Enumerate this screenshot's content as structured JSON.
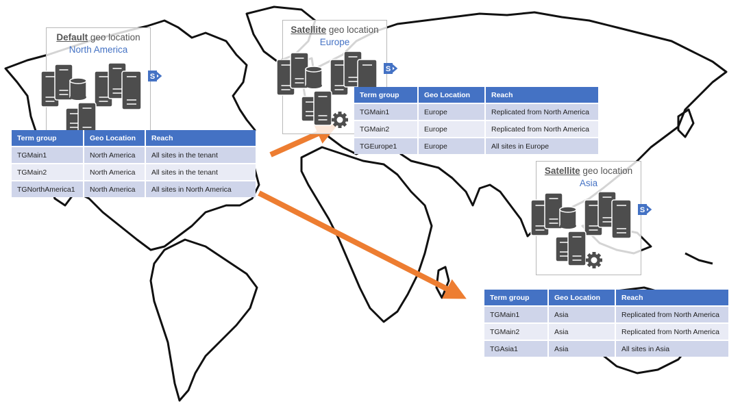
{
  "colors": {
    "accent": "#4472c4",
    "arrow": "#ed7d31",
    "server": "#4d4d4d",
    "row_odd": "#cfd5ea",
    "row_even": "#e9ebf5"
  },
  "table_headers": [
    "Term group",
    "Geo Location",
    "Reach"
  ],
  "locations": [
    {
      "kind": "Default",
      "suffix": " geo location",
      "name": "North America",
      "rows": [
        [
          "TGMain1",
          "North America",
          "All sites in the tenant"
        ],
        [
          "TGMain2",
          "North America",
          "All sites in the tenant"
        ],
        [
          "TGNorthAmerica1",
          "North America",
          "All sites in North America"
        ]
      ]
    },
    {
      "kind": "Satellite",
      "suffix": " geo location",
      "name": "Europe",
      "rows": [
        [
          "TGMain1",
          "Europe",
          "Replicated from North America"
        ],
        [
          "TGMain2",
          "Europe",
          "Replicated from North America"
        ],
        [
          "TGEurope1",
          "Europe",
          "All sites in Europe"
        ]
      ]
    },
    {
      "kind": "Satellite",
      "suffix": " geo location",
      "name": "Asia",
      "rows": [
        [
          "TGMain1",
          "Asia",
          "Replicated from North America"
        ],
        [
          "TGMain2",
          "Asia",
          "Replicated from North America"
        ],
        [
          "TGAsia1",
          "Asia",
          "All sites in Asia"
        ]
      ]
    }
  ],
  "icons": {
    "server": "server-icon",
    "database": "database-icon",
    "gear": "gear-icon",
    "sharepoint": "sharepoint-icon"
  },
  "sharepoint_letter": "S",
  "arrows": [
    {
      "from": "North America",
      "to": "Europe"
    },
    {
      "from": "North America",
      "to": "Asia"
    }
  ]
}
